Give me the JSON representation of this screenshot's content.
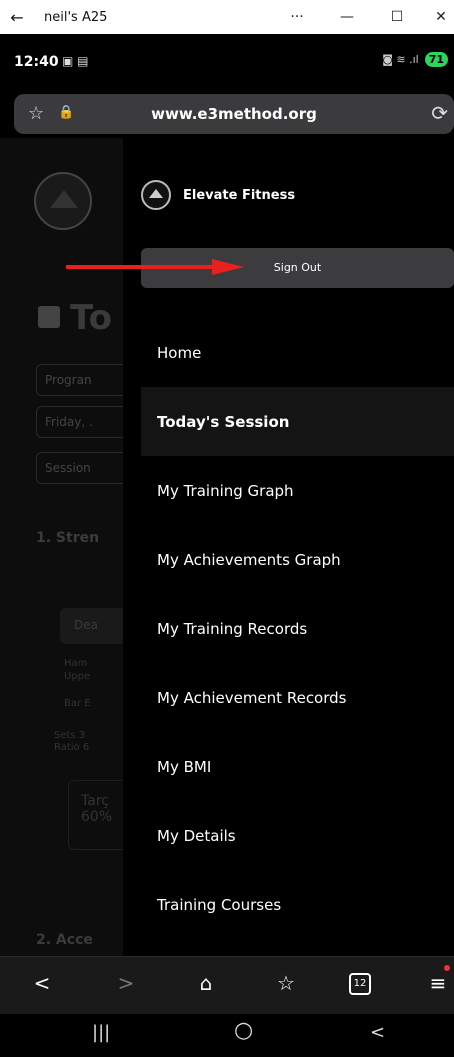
{
  "window": {
    "back": "←",
    "title": "neil's A25",
    "more": "···",
    "minimize": "—",
    "maximize": "☐",
    "close": "✕"
  },
  "status": {
    "time": "12:40",
    "left_icons": "▣ ▤",
    "right_icons": "◙ ≋ .ıl",
    "battery": "71"
  },
  "address": {
    "url": "www.e3method.org",
    "star_icon": "☆",
    "lock_icon": "🔒",
    "reload_icon": "⟳"
  },
  "background_page": {
    "title_fragment": "To",
    "pills": [
      "Progran",
      "Friday, .",
      "Session"
    ],
    "section1": "1. Stren",
    "card": "Dea",
    "small_texts": [
      "Ham",
      "Uppe",
      "Bar E",
      "Sets 3",
      "Ratio 6"
    ],
    "target": "Tarç",
    "target_value": "60%",
    "section2": "2. Acce",
    "close_icon": "✕"
  },
  "drawer": {
    "brand": "Elevate Fitness",
    "sign_out": "Sign Out",
    "menu": [
      {
        "label": "Home"
      },
      {
        "label": "Today's Session",
        "active": true
      },
      {
        "label": "My Training Graph"
      },
      {
        "label": "My Achievements Graph"
      },
      {
        "label": "My Training Records"
      },
      {
        "label": "My Achievement Records"
      },
      {
        "label": "My BMI"
      },
      {
        "label": "My Details"
      },
      {
        "label": "Training Courses"
      }
    ]
  },
  "toolbar": {
    "back": "<",
    "forward": ">",
    "home": "⌂",
    "favorites": "☆",
    "tabs_count": "12",
    "menu": "≡"
  },
  "navbar": {
    "recents": "|||",
    "home": "○",
    "back": "<"
  },
  "colors": {
    "arrow": "#e82020",
    "signout_bg": "#3c3c3e",
    "battery": "#2bd65a"
  }
}
